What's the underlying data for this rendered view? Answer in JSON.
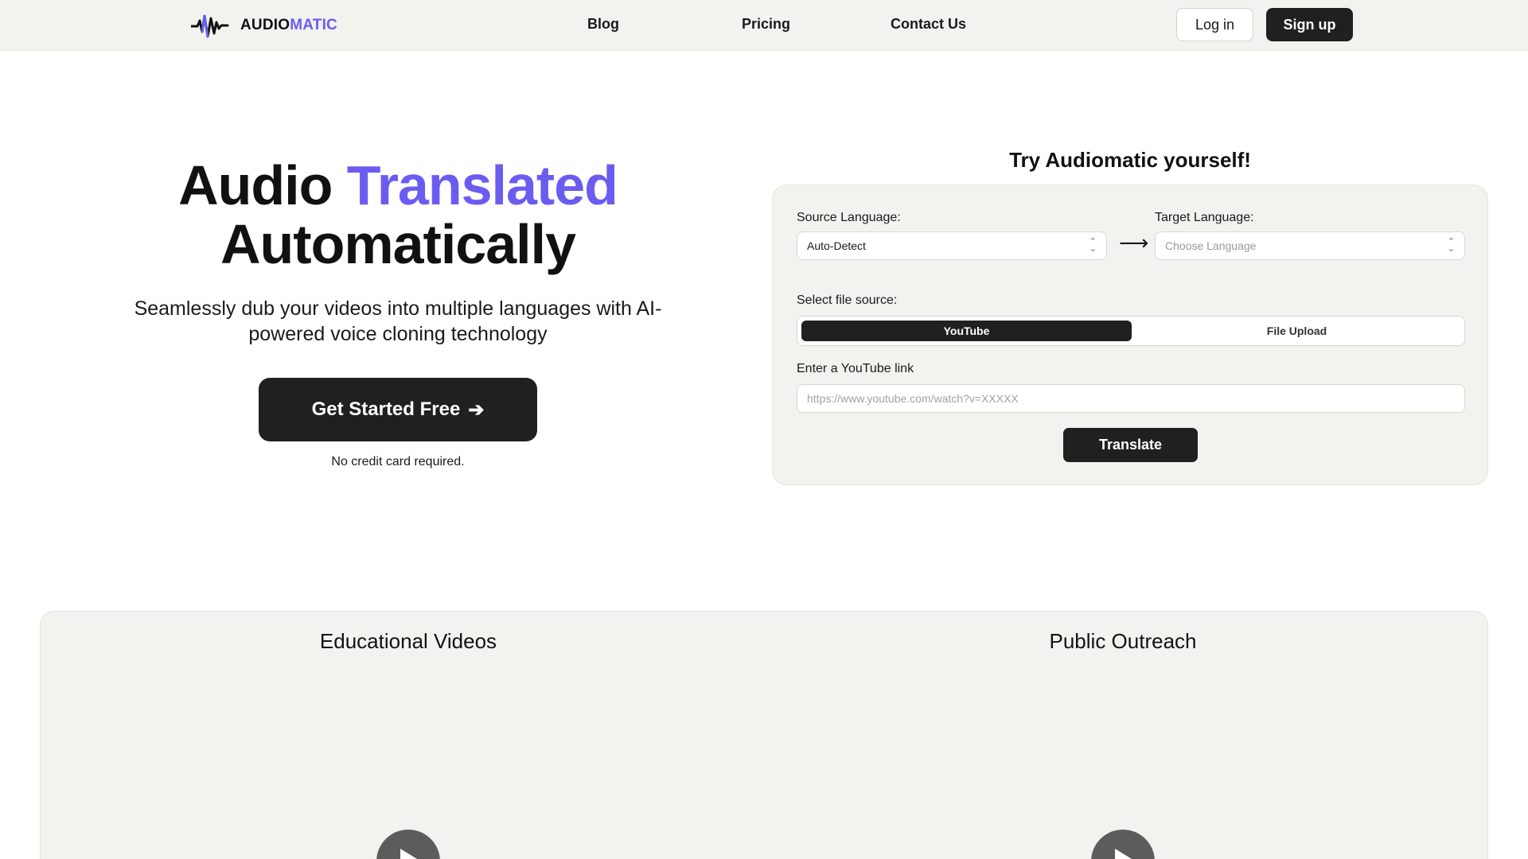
{
  "nav": {
    "brand_a": "AUDIO",
    "brand_b": "MATIC",
    "links": [
      "Blog",
      "Pricing",
      "Contact Us"
    ],
    "login": "Log in",
    "signup": "Sign up"
  },
  "hero": {
    "title_a": "Audio",
    "title_accent": "Translated",
    "title_b": "Automatically",
    "subtitle": "Seamlessly dub your videos into multiple languages with AI-powered voice cloning technology",
    "cta": "Get Started Free",
    "cta_arrow": "➔",
    "note": "No credit card required."
  },
  "try": {
    "title": "Try Audiomatic yourself!",
    "source_label": "Source Language:",
    "source_value": "Auto-Detect",
    "arrow": "⟶",
    "target_label": "Target Language:",
    "target_placeholder": "Choose Language",
    "file_source_label": "Select file source:",
    "tab_youtube": "YouTube",
    "tab_upload": "File Upload",
    "link_label": "Enter a YouTube link",
    "link_placeholder": "https://www.youtube.com/watch?v=XXXXX",
    "translate": "Translate"
  },
  "cases": {
    "left_title": "Educational Videos",
    "right_title": "Public Outreach"
  },
  "colors": {
    "accent": "#6b5cf0",
    "dark": "#202020",
    "panel": "#f2f2ee"
  }
}
